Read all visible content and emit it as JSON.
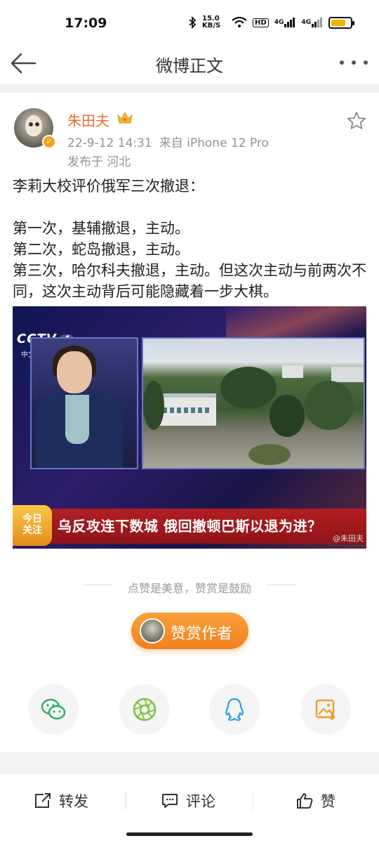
{
  "status_bar": {
    "time": "17:09",
    "net_speed": "15.0 KB/S",
    "hd_label": "HD",
    "signal1": "4G",
    "signal2": "4G",
    "battery_level": 0.75
  },
  "nav": {
    "title": "微博正文"
  },
  "post": {
    "author": "朱田夫",
    "datetime": "22-9-12 14:31",
    "source": "来自 iPhone 12 Pro",
    "location": "发布于 河北",
    "text_lines": [
      "李莉大校评价俄军三次撤退：",
      "",
      "第一次，基辅撤退，主动。",
      "第二次，蛇岛撤退，主动。",
      "第三次，哈尔科夫撤退，主动。但这次主动与前两次不同，这次主动背后可能隐藏着一步大棋。"
    ]
  },
  "media": {
    "channel_logo": "CCTV",
    "channel_number": "4",
    "channel_sub": "中文国际",
    "banner_tag": "今日关注",
    "banner_tag_line1": "今日",
    "banner_tag_line2": "关注",
    "headline": "乌反攻连下数城  俄回撤顿巴斯以退为进？",
    "watermark": "@朱田夫"
  },
  "reward": {
    "hint": "点赞是美意，赞赏是鼓励",
    "button_label": "赞赏作者"
  },
  "share": {
    "items": [
      {
        "icon": "wechat-icon",
        "color": "#2aae67"
      },
      {
        "icon": "moments-icon",
        "color": "#7cc242"
      },
      {
        "icon": "qq-icon",
        "color": "#26a1e8"
      },
      {
        "icon": "save-image-icon",
        "color": "#f39b2c"
      }
    ]
  },
  "bottom_bar": {
    "repost": "转发",
    "comment": "评论",
    "like": "赞"
  },
  "colors": {
    "author": "#e7712a",
    "accent": "#f2801f"
  }
}
